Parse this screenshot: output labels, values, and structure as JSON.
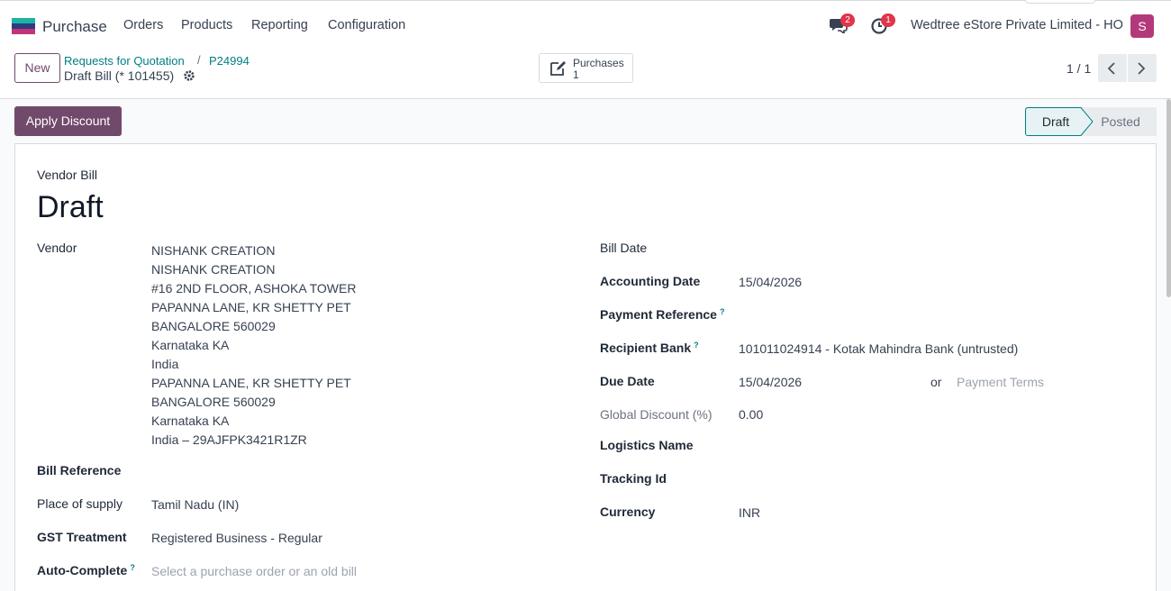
{
  "navbar": {
    "app_name": "Purchase",
    "menu": [
      "Orders",
      "Products",
      "Reporting",
      "Configuration"
    ],
    "messages_count": "2",
    "activities_count": "1",
    "company": "Wedtree eStore Private Limited - HO",
    "avatar_initial": "S"
  },
  "control_panel": {
    "new_label": "New",
    "breadcrumbs": [
      "Requests for Quotation",
      "P24994"
    ],
    "breadcrumb_sep": "/",
    "current_record": "Draft Bill (* 101455)",
    "smart_button": {
      "label": "Purchases",
      "count": "1"
    },
    "pager": "1 / 1"
  },
  "actions": {
    "apply_discount": "Apply Discount"
  },
  "statusbar": {
    "stages": [
      "Draft",
      "Posted"
    ],
    "active": "Draft"
  },
  "form": {
    "doc_type": "Vendor Bill",
    "doc_name": "Draft",
    "left": {
      "vendor_label": "Vendor",
      "vendor_address": [
        "NISHANK CREATION",
        "NISHANK CREATION",
        "#16 2ND FLOOR, ASHOKA TOWER",
        "PAPANNA LANE, KR SHETTY PET",
        "BANGALORE 560029",
        "Karnataka KA",
        "India",
        "PAPANNA LANE, KR SHETTY PET",
        "BANGALORE 560029",
        "Karnataka KA",
        "India – 29AJFPK3421R1ZR"
      ],
      "bill_reference_label": "Bill Reference",
      "place_of_supply_label": "Place of supply",
      "place_of_supply": "Tamil Nadu (IN)",
      "gst_treatment_label": "GST Treatment",
      "gst_treatment": "Registered Business - Regular",
      "auto_complete_label": "Auto-Complete",
      "auto_complete_placeholder": "Select a purchase order or an old bill"
    },
    "right": {
      "bill_date_label": "Bill Date",
      "accounting_date_label": "Accounting Date",
      "accounting_date": "15/04/2026",
      "payment_reference_label": "Payment Reference",
      "recipient_bank_label": "Recipient Bank",
      "recipient_bank": "101011024914 - Kotak Mahindra Bank (untrusted)",
      "due_date_label": "Due Date",
      "due_date": "15/04/2026",
      "or_text": "or",
      "payment_terms_placeholder": "Payment Terms",
      "global_discount_label": "Global Discount (%)",
      "global_discount": "0.00",
      "logistics_name_label": "Logistics Name",
      "tracking_id_label": "Tracking Id",
      "currency_label": "Currency",
      "currency": "INR"
    },
    "help_mark": "?"
  },
  "colors": {
    "brand": "#71496b",
    "link": "#017e84",
    "badge": "#e0354a",
    "avatar": "#b33a7a",
    "status_active_bg": "#e6f2f3"
  }
}
